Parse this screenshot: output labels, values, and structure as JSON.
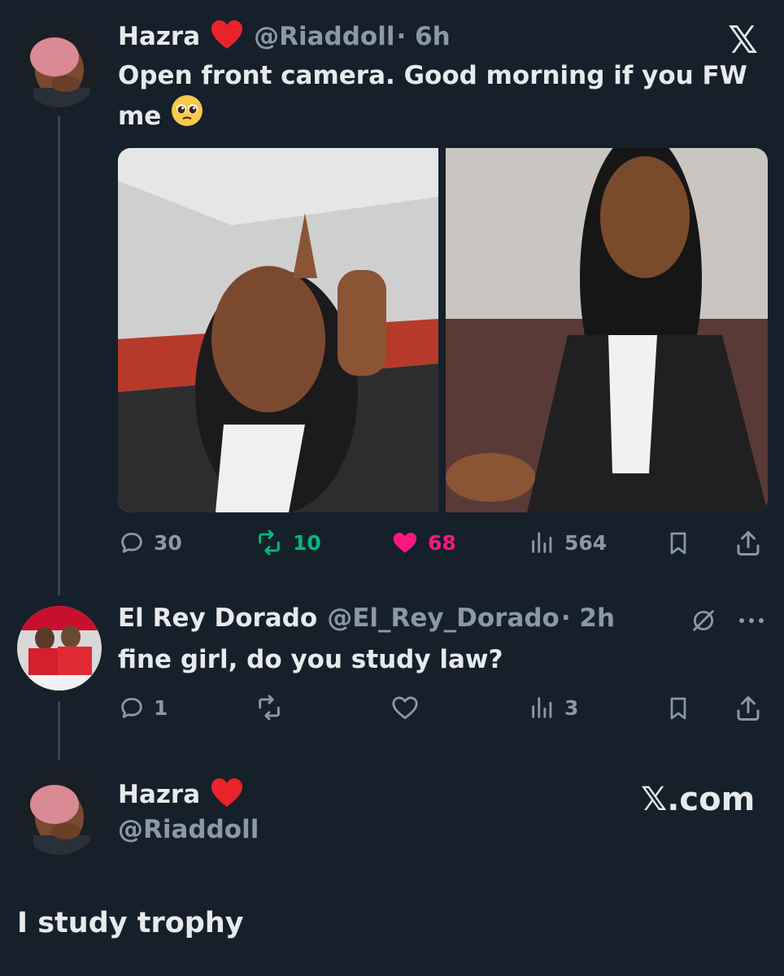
{
  "tweet1": {
    "name": "Hazra",
    "handle": "@Riaddoll",
    "time": "· 6h",
    "text_line1": "Open front camera. Good morning if you FW",
    "text_line2": "me",
    "close_glyph": "𝕏",
    "stats": {
      "replies": "30",
      "reposts": "10",
      "likes": "68",
      "views": "564"
    },
    "colors": {
      "repost": "#00ba7c",
      "like": "#f91880"
    }
  },
  "tweet2": {
    "name": "El Rey Dorado",
    "handle": "@El_Rey_Dorado",
    "time": "· 2h",
    "text": "fine girl, do you study law?",
    "stats": {
      "replies": "1",
      "views": "3"
    }
  },
  "tweet3": {
    "name": "Hazra",
    "handle": "@Riaddoll",
    "brand": "𝕏.com",
    "text": "I study trophy"
  },
  "icons": [
    "heart-emoji",
    "pleading-face-emoji",
    "x-logo",
    "reply-icon",
    "repost-icon",
    "like-icon",
    "views-icon",
    "bookmark-icon",
    "share-icon",
    "grok-icon",
    "more-icon"
  ]
}
